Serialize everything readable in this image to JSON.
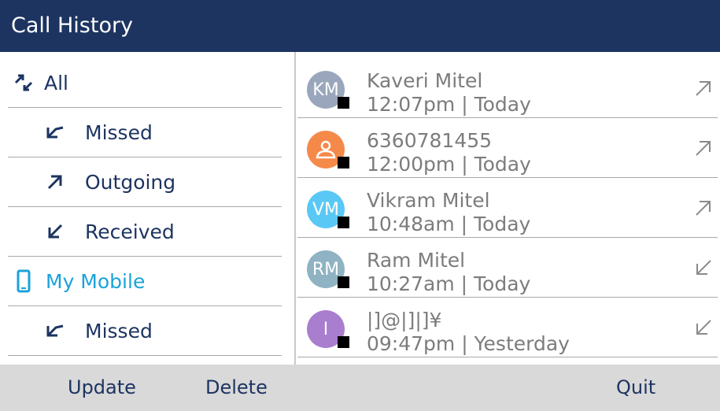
{
  "header": {
    "title": "Call History"
  },
  "filters": [
    {
      "label": "All",
      "icon": "all-calls-icon"
    },
    {
      "label": "Missed",
      "icon": "missed-call-icon"
    },
    {
      "label": "Outgoing",
      "icon": "outgoing-call-icon"
    },
    {
      "label": "Received",
      "icon": "received-call-icon"
    },
    {
      "label": "My Mobile",
      "icon": "mobile-phone-icon"
    },
    {
      "label": "Missed",
      "icon": "missed-call-icon"
    }
  ],
  "calls": [
    {
      "initials": "KM",
      "avatar_color": "#9aa6bb",
      "name": "Kaveri Mitel",
      "time": "12:07pm | Today",
      "direction": "outgoing"
    },
    {
      "initials": "",
      "avatar_color": "#f5894a",
      "name": "6360781455",
      "time": "12:00pm | Today",
      "direction": "outgoing"
    },
    {
      "initials": "VM",
      "avatar_color": "#5ac8f5",
      "name": "Vikram Mitel",
      "time": "10:48am | Today",
      "direction": "outgoing"
    },
    {
      "initials": "RM",
      "avatar_color": "#8fb3c2",
      "name": "Ram Mitel",
      "time": "10:27am | Today",
      "direction": "received"
    },
    {
      "initials": "I",
      "avatar_color": "#a97ecf",
      "name": "|]@|]|]¥",
      "time": "09:47pm | Yesterday",
      "direction": "received"
    }
  ],
  "softkeys": {
    "update": "Update",
    "delete": "Delete",
    "quit": "Quit"
  },
  "colors": {
    "header_bg": "#1d3461",
    "accent": "#1aa3d9",
    "softkey_bg": "#d9d9d9"
  }
}
